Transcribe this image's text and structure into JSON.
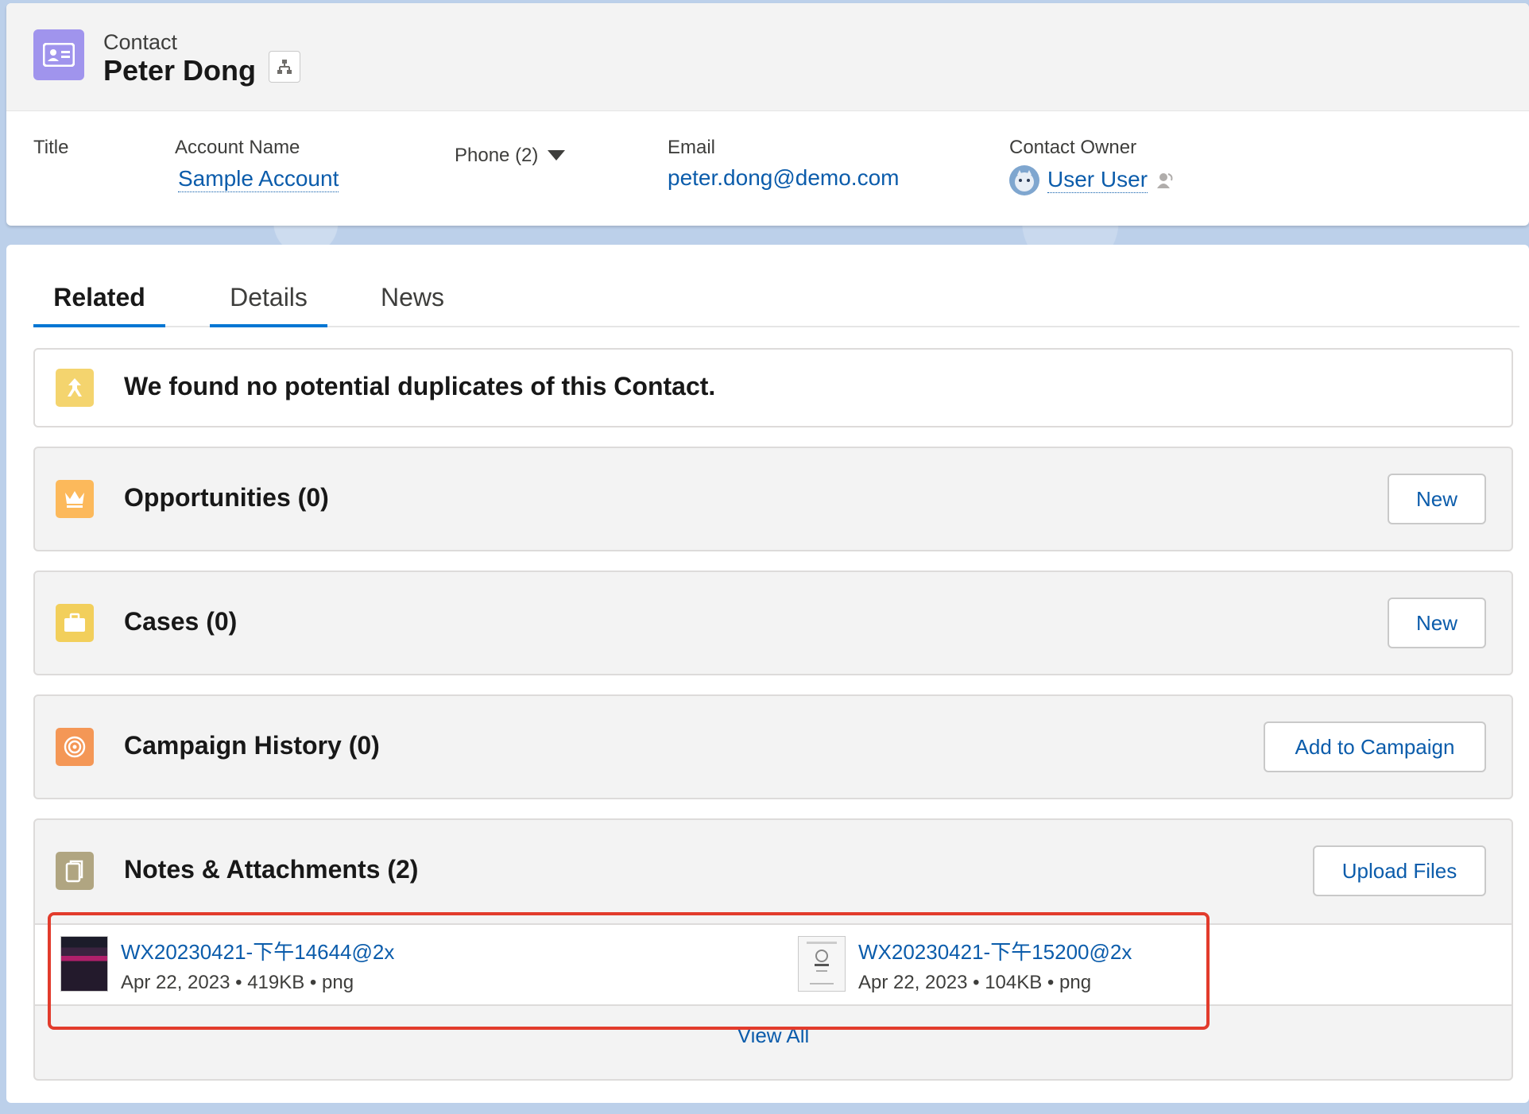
{
  "header": {
    "object_label": "Contact",
    "record_name": "Peter Dong",
    "fields": {
      "title_label": "Title",
      "account_label": "Account Name",
      "account_value": "Sample Account",
      "phone_label": "Phone (2)",
      "email_label": "Email",
      "email_value": "peter.dong@demo.com",
      "owner_label": "Contact Owner",
      "owner_value": "User User"
    }
  },
  "tabs": [
    {
      "label": "Related"
    },
    {
      "label": "Details"
    },
    {
      "label": "News"
    }
  ],
  "duplicates": {
    "message": "We found no potential duplicates of this Contact."
  },
  "related_lists": [
    {
      "title": "Opportunities (0)",
      "button": "New"
    },
    {
      "title": "Cases (0)",
      "button": "New"
    },
    {
      "title": "Campaign History (0)",
      "button": "Add to Campaign"
    }
  ],
  "notes": {
    "title": "Notes & Attachments (2)",
    "button": "Upload Files",
    "files": [
      {
        "name": "WX20230421-下午14644@2x",
        "date": "Apr 22, 2023",
        "size": "419KB",
        "type": "png"
      },
      {
        "name": "WX20230421-下午15200@2x",
        "date": "Apr 22, 2023",
        "size": "104KB",
        "type": "png"
      }
    ],
    "view_all": "View All"
  },
  "colors": {
    "contact_icon": "#a094ed",
    "duplicates_icon": "#f4d46e",
    "opportunity_icon": "#fcb95b",
    "case_icon": "#f2cf5b",
    "campaign_icon": "#f49756",
    "notes_icon": "#b0a581",
    "link": "#0b5cab",
    "tab_active": "#0176d3",
    "highlight": "#e23b2c"
  }
}
